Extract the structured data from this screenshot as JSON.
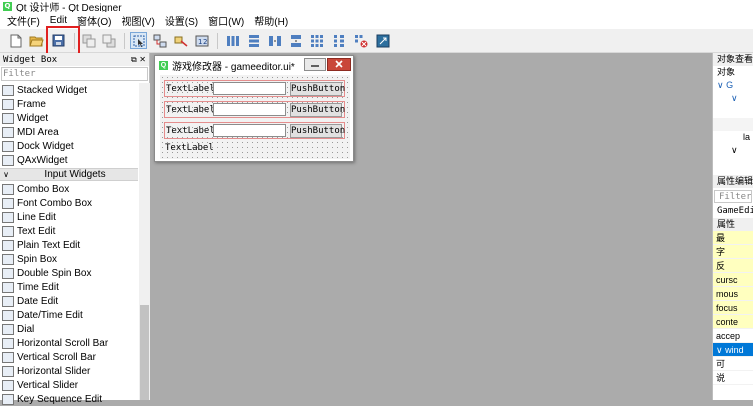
{
  "window": {
    "title": "Qt 设计师 - Qt Designer"
  },
  "menu": [
    "文件(F)",
    "Edit",
    "窗体(O)",
    "视图(V)",
    "设置(S)",
    "窗口(W)",
    "帮助(H)"
  ],
  "widget_box": {
    "title": "Widget Box",
    "controls": "⧉ ✕",
    "filter_placeholder": "Filter",
    "items_top": [
      {
        "label": "Stacked Widget",
        "icon": "stacked-widget-icon"
      },
      {
        "label": "Frame",
        "icon": "frame-icon"
      },
      {
        "label": "Widget",
        "icon": "widget-icon"
      },
      {
        "label": "MDI Area",
        "icon": "mdi-area-icon"
      },
      {
        "label": "Dock Widget",
        "icon": "dock-widget-icon"
      },
      {
        "label": "QAxWidget",
        "icon": "qaxwidget-icon"
      }
    ],
    "category": "Input Widgets",
    "items_input": [
      {
        "label": "Combo Box",
        "icon": "combo-box-icon"
      },
      {
        "label": "Font Combo Box",
        "icon": "font-combo-box-icon"
      },
      {
        "label": "Line Edit",
        "icon": "line-edit-icon"
      },
      {
        "label": "Text Edit",
        "icon": "text-edit-icon"
      },
      {
        "label": "Plain Text Edit",
        "icon": "plain-text-edit-icon"
      },
      {
        "label": "Spin Box",
        "icon": "spin-box-icon"
      },
      {
        "label": "Double Spin Box",
        "icon": "double-spin-box-icon"
      },
      {
        "label": "Time Edit",
        "icon": "time-edit-icon"
      },
      {
        "label": "Date Edit",
        "icon": "date-edit-icon"
      },
      {
        "label": "Date/Time Edit",
        "icon": "date-time-edit-icon"
      },
      {
        "label": "Dial",
        "icon": "dial-icon"
      },
      {
        "label": "Horizontal Scroll Bar",
        "icon": "horizontal-scroll-bar-icon"
      },
      {
        "label": "Vertical Scroll Bar",
        "icon": "vertical-scroll-bar-icon"
      },
      {
        "label": "Horizontal Slider",
        "icon": "horizontal-slider-icon"
      },
      {
        "label": "Vertical Slider",
        "icon": "vertical-slider-icon"
      },
      {
        "label": "Key Sequence Edit",
        "icon": "key-sequence-edit-icon"
      }
    ]
  },
  "form_window": {
    "title": "游戏修改器 - gameeditor.ui*",
    "rows": [
      {
        "label": "TextLabel",
        "button": "PushButton"
      },
      {
        "label": "TextLabel",
        "button": "PushButton"
      },
      {
        "label": "TextLabel",
        "button": "PushButton"
      }
    ],
    "bottom_label": "TextLabel"
  },
  "object_inspector": {
    "title": "对象查看器",
    "column": "对象",
    "tree": [
      "∨ G",
      "∨",
      "",
      "",
      "la",
      "∨"
    ]
  },
  "property_editor": {
    "title": "属性编辑器",
    "filter_placeholder": "Filter",
    "object": "GameEdit",
    "header": "属性",
    "rows": [
      {
        "label": "最",
        "style": "yel"
      },
      {
        "label": "字",
        "style": "yel"
      },
      {
        "label": "反",
        "style": "yel"
      },
      {
        "label": "cursc",
        "style": "yel"
      },
      {
        "label": "mous",
        "style": "yel"
      },
      {
        "label": "focus",
        "style": "yel"
      },
      {
        "label": "conte",
        "style": "yel"
      },
      {
        "label": "accep",
        "style": ""
      },
      {
        "label": "∨ wind",
        "style": "sel"
      },
      {
        "label": "可",
        "style": ""
      },
      {
        "label": "说",
        "style": ""
      }
    ]
  },
  "colors": {
    "highlight_box": "#e02020",
    "selection": "#0078d7",
    "property_yellow": "#ffffbf"
  }
}
